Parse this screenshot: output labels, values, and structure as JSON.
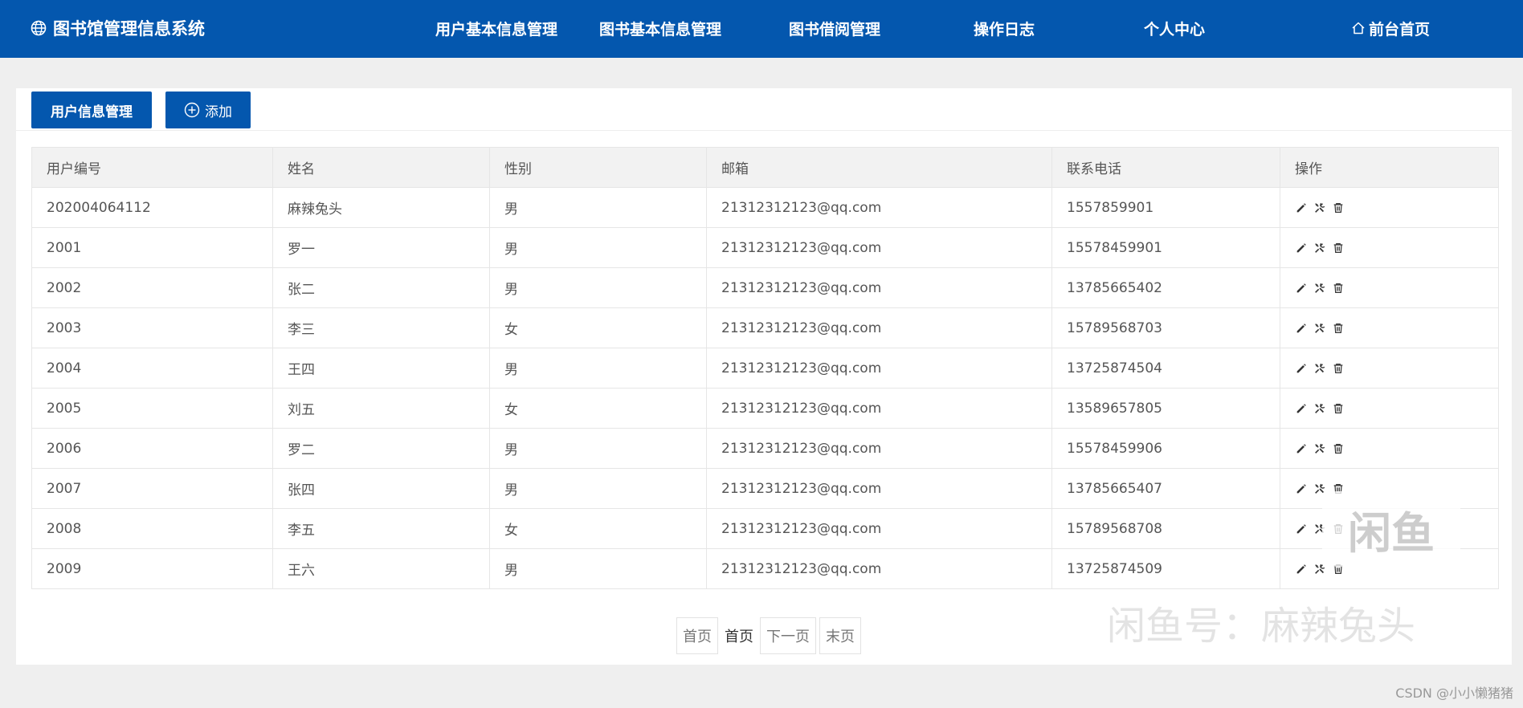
{
  "header": {
    "title": "图书馆管理信息系统",
    "nav": [
      {
        "id": "users",
        "label": "用户基本信息管理"
      },
      {
        "id": "books",
        "label": "图书基本信息管理"
      },
      {
        "id": "borrow",
        "label": "图书借阅管理"
      },
      {
        "id": "logs",
        "label": "操作日志"
      },
      {
        "id": "profile",
        "label": "个人中心"
      },
      {
        "id": "home",
        "label": "前台首页"
      }
    ]
  },
  "toolbar": {
    "title_label": "用户信息管理",
    "add_label": "添加"
  },
  "table": {
    "columns": [
      "用户编号",
      "姓名",
      "性别",
      "邮箱",
      "联系电话",
      "操作"
    ],
    "rows": [
      [
        "202004064112",
        "麻辣兔头",
        "男",
        "21312312123@qq.com",
        "1557859901"
      ],
      [
        "2001",
        "罗一",
        "男",
        "21312312123@qq.com",
        "15578459901"
      ],
      [
        "2002",
        "张二",
        "男",
        "21312312123@qq.com",
        "13785665402"
      ],
      [
        "2003",
        "李三",
        "女",
        "21312312123@qq.com",
        "15789568703"
      ],
      [
        "2004",
        "王四",
        "男",
        "21312312123@qq.com",
        "13725874504"
      ],
      [
        "2005",
        "刘五",
        "女",
        "21312312123@qq.com",
        "13589657805"
      ],
      [
        "2006",
        "罗二",
        "男",
        "21312312123@qq.com",
        "15578459906"
      ],
      [
        "2007",
        "张四",
        "男",
        "21312312123@qq.com",
        "13785665407"
      ],
      [
        "2008",
        "李五",
        "女",
        "21312312123@qq.com",
        "15789568708"
      ],
      [
        "2009",
        "王六",
        "男",
        "21312312123@qq.com",
        "13725874509"
      ]
    ],
    "row_actions": [
      "edit-icon",
      "tools-icon",
      "trash-icon"
    ]
  },
  "pagination": {
    "first": "首页",
    "current": "首页",
    "next": "下一页",
    "last": "末页"
  },
  "watermarks": {
    "logo_text": "闲鱼",
    "seller": "闲鱼号：麻辣兔头",
    "csdn": "CSDN @小小懒猪猪"
  },
  "colors": {
    "primary": "#0457ae",
    "page_bg": "#efefef",
    "header_bg": "#f2f2f2"
  }
}
